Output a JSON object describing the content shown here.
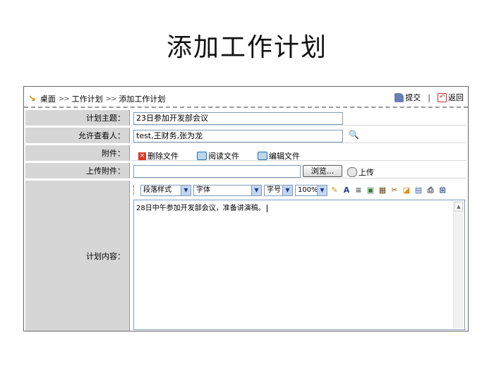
{
  "slide_title": "添加工作计划",
  "breadcrumb": [
    "桌面",
    "工作计划",
    "添加工作计划"
  ],
  "actions": {
    "submit": "提交",
    "back": "返回"
  },
  "form": {
    "subject_label": "计划主题：",
    "subject_value": "23日参加开发部会议",
    "viewers_label": "允许查看人：",
    "viewers_value": "test,王财务,张为龙",
    "attach_label": "附件：",
    "attach_buttons": [
      "删除文件",
      "阅读文件",
      "编辑文件"
    ],
    "upload_label": "上传附件：",
    "browse_label": "浏览...",
    "upload_button": "上传",
    "content_label": "计划内容：",
    "content_text": "28日中午参加开发部会议，准备讲演稿。"
  },
  "editor_toolbar": {
    "paragraph_style": "段落样式",
    "font": "字体",
    "font_size": "字号",
    "zoom": "100%"
  },
  "colors": {
    "label_bg": "#d6d6d6",
    "accent": "#e28a00",
    "border": "#7f9db9"
  }
}
